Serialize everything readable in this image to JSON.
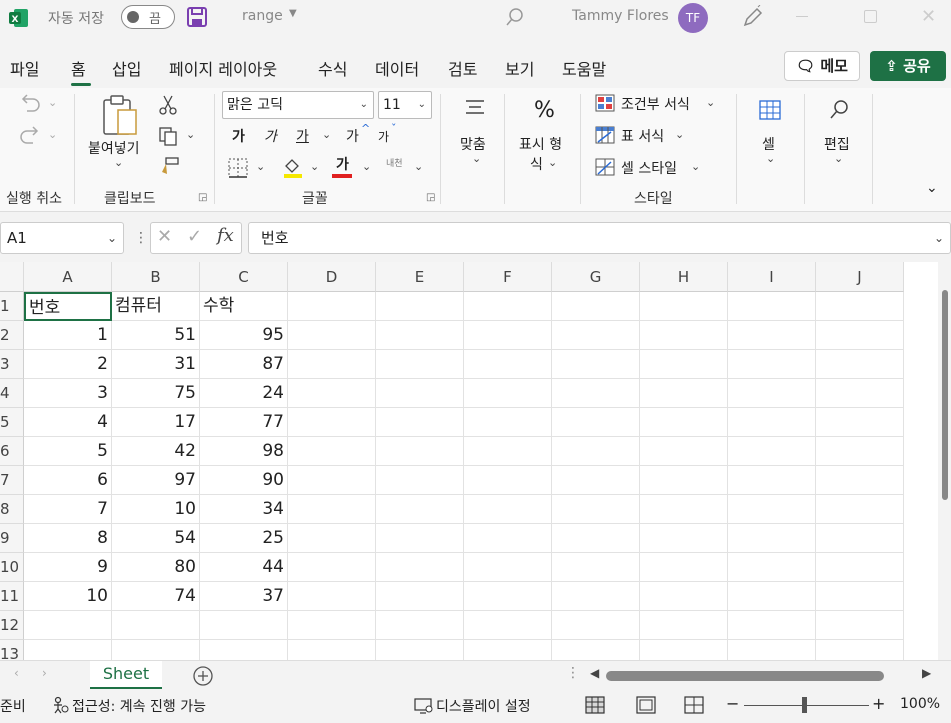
{
  "titlebar": {
    "autosave_label": "자동 저장",
    "autosave_state": "끔",
    "filename": "range",
    "username": "Tammy Flores",
    "user_initials": "TF"
  },
  "menu": {
    "items": [
      "파일",
      "홈",
      "삽입",
      "페이지 레이아웃",
      "수식",
      "데이터",
      "검토",
      "보기",
      "도움말"
    ],
    "active": "홈",
    "memo_label": "메모",
    "share_label": "공유"
  },
  "ribbon": {
    "undo_group": "실행 취소",
    "clipboard_group": "클립보드",
    "paste_label": "붙여넣기",
    "font_group": "글꼴",
    "font_name": "맑은 고딕",
    "font_size": "11",
    "bold": "가",
    "italic": "가",
    "underline": "가",
    "grow_font": "가",
    "shrink_font": "가",
    "font_color": "가",
    "phonetic": "내천",
    "align_label": "맞춤",
    "number_format_line1": "표시 형",
    "number_format_line2": "식",
    "conditional_format": "조건부 서식",
    "table_format": "표 서식",
    "cell_styles": "셀 스타일",
    "styles_group": "스타일",
    "cells_label": "셀",
    "edit_label": "편집"
  },
  "formula_bar": {
    "name_box": "A1",
    "content": "번호"
  },
  "sheet": {
    "columns": [
      "A",
      "B",
      "C",
      "D",
      "E",
      "F",
      "G",
      "H",
      "I",
      "J"
    ],
    "row_numbers": [
      "1",
      "2",
      "3",
      "4",
      "5",
      "6",
      "7",
      "8",
      "9",
      "10",
      "11",
      "12",
      "13"
    ],
    "rows": [
      [
        "번호",
        "컴퓨터",
        "수학"
      ],
      [
        "1",
        "51",
        "95"
      ],
      [
        "2",
        "31",
        "87"
      ],
      [
        "3",
        "75",
        "24"
      ],
      [
        "4",
        "17",
        "77"
      ],
      [
        "5",
        "42",
        "98"
      ],
      [
        "6",
        "97",
        "90"
      ],
      [
        "7",
        "10",
        "34"
      ],
      [
        "8",
        "54",
        "25"
      ],
      [
        "9",
        "80",
        "44"
      ],
      [
        "10",
        "74",
        "37"
      ]
    ]
  },
  "tabs": {
    "sheet_name": "Sheet"
  },
  "status": {
    "ready": "준비",
    "accessibility": "접근성: 계속 진행 가능",
    "display_settings": "디스플레이 설정",
    "zoom": "100%"
  },
  "colors": {
    "accent": "#1e7145",
    "avatar": "#8e6bbf",
    "save_icon": "#7a3fb0",
    "highlight": "#f5e800",
    "font_color": "#e02020"
  }
}
